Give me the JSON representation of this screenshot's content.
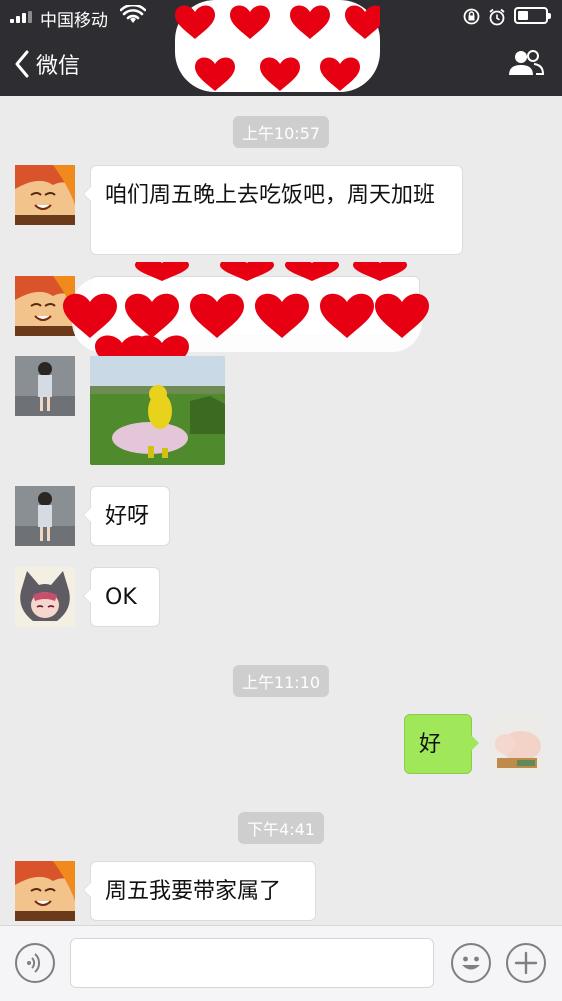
{
  "status_bar": {
    "carrier": "中国移动"
  },
  "nav": {
    "back_label": "微信"
  },
  "timestamps": [
    "上午10:57",
    "上午11:10",
    "下午4:41"
  ],
  "messages": [
    {
      "side": "left",
      "sender": "boy",
      "text": "咱们周五晚上去吃饭吧，周天加班"
    },
    {
      "side": "left",
      "sender": "boy",
      "text": ""
    },
    {
      "side": "left",
      "sender": "girl",
      "text": ""
    },
    {
      "side": "left",
      "sender": "girl",
      "text": "好呀"
    },
    {
      "side": "left",
      "sender": "cat",
      "text": "OK"
    },
    {
      "side": "right",
      "sender": "me",
      "text": "好"
    },
    {
      "side": "left",
      "sender": "boy",
      "text": "周五我要带家属了"
    }
  ],
  "input": {
    "placeholder": ""
  },
  "colors": {
    "navbar": "#2e2e32",
    "background": "#ebebeb",
    "self_bubble": "#a0e75a",
    "other_bubble": "#ffffff",
    "censor_heart": "#e60012"
  }
}
